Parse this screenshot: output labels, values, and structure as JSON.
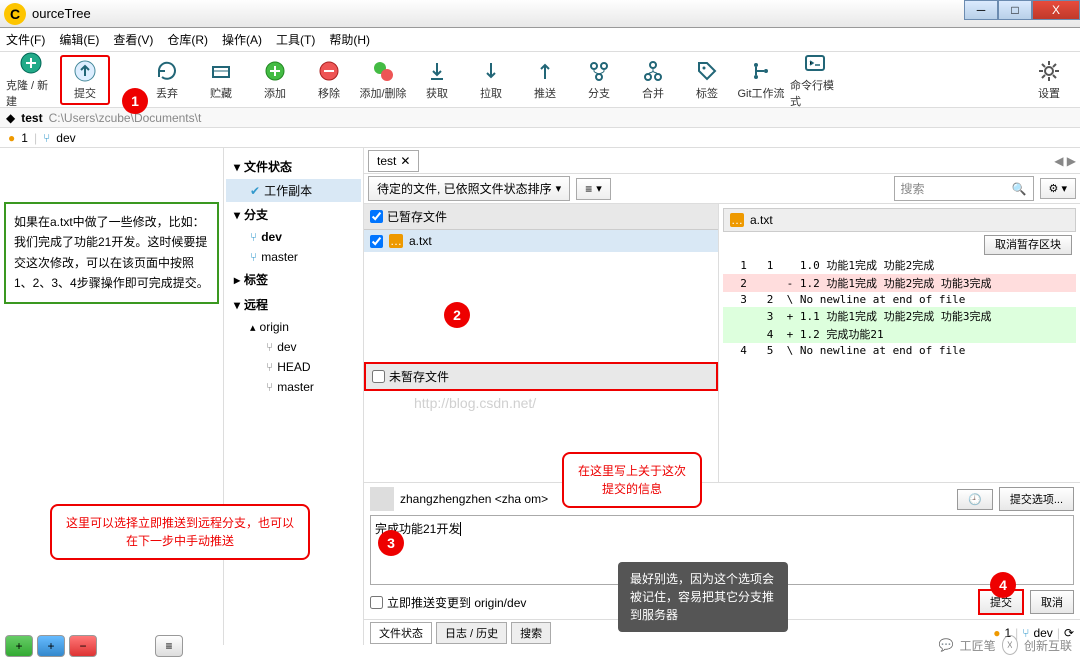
{
  "window": {
    "title": "ourceTree",
    "min": "_",
    "max": "□",
    "close": "X"
  },
  "menu": [
    "文件(F)",
    "编辑(E)",
    "查看(V)",
    "仓库(R)",
    "操作(A)",
    "工具(T)",
    "帮助(H)"
  ],
  "toolbar": [
    {
      "label": "克隆 / 新建",
      "icon": "clone"
    },
    {
      "label": "提交",
      "icon": "commit",
      "hl": true
    },
    {
      "label": "丢弃",
      "icon": "discard"
    },
    {
      "label": "贮藏",
      "icon": "stash"
    },
    {
      "label": "添加",
      "icon": "add"
    },
    {
      "label": "移除",
      "icon": "remove"
    },
    {
      "label": "添加/删除",
      "icon": "addremove"
    },
    {
      "label": "获取",
      "icon": "fetch"
    },
    {
      "label": "拉取",
      "icon": "pull"
    },
    {
      "label": "推送",
      "icon": "push"
    },
    {
      "label": "分支",
      "icon": "branch"
    },
    {
      "label": "合并",
      "icon": "merge"
    },
    {
      "label": "标签",
      "icon": "tag"
    },
    {
      "label": "Git工作流",
      "icon": "flow"
    },
    {
      "label": "命令行模式",
      "icon": "terminal"
    }
  ],
  "settings_label": "设置",
  "path": {
    "repo": "test",
    "full": "C:\\Users\\zcube\\Documents\\t"
  },
  "branch_badge": "1",
  "branch_current": "dev",
  "note_text": "如果在a.txt中做了一些修改，比如：我们完成了功能21开发。这时候要提交这次修改，可以在该页面中按照1、2、3、4步骤操作即可完成提交。",
  "tree": {
    "file_status": "文件状态",
    "working_copy": "工作副本",
    "branches": "分支",
    "dev": "dev",
    "master_b": "master",
    "tags": "标签",
    "remotes": "远程",
    "origin": "origin",
    "r_dev": "dev",
    "r_head": "HEAD",
    "r_master": "master"
  },
  "tab": "test",
  "sort_label": "待定的文件, 已依照文件状态排序",
  "view_btn": "≡",
  "search_ph": "搜索",
  "staged_hdr": "已暂存文件",
  "staged_file": "a.txt",
  "unstaged_hdr": "未暂存文件",
  "ghost_url": "http://blog.csdn.net/",
  "diff": {
    "file": "a.txt",
    "unstage_btn": "取消暂存区块",
    "lines": [
      {
        "t": "ctx",
        "ol": "1",
        "nl": "1",
        "txt": "  1.0 功能1完成 功能2完成"
      },
      {
        "t": "del",
        "ol": "2",
        "nl": "",
        "txt": "- 1.2 功能1完成 功能2完成 功能3完成"
      },
      {
        "t": "ctx",
        "ol": "3",
        "nl": "2",
        "txt": "\\ No newline at end of file"
      },
      {
        "t": "add",
        "ol": "",
        "nl": "3",
        "txt": "+ 1.1 功能1完成 功能2完成 功能3完成"
      },
      {
        "t": "add",
        "ol": "",
        "nl": "4",
        "txt": "+ 1.2 完成功能21"
      },
      {
        "t": "ctx",
        "ol": "4",
        "nl": "5",
        "txt": "\\ No newline at end of file"
      }
    ]
  },
  "commit": {
    "user": "zhangzhengzhen <zha                                           om>",
    "msg": "完成功能21开发",
    "push_checkbox": "立即推送变更到 origin/dev",
    "options": "提交选项...",
    "commit_btn": "提交",
    "cancel_btn": "取消"
  },
  "callout1": "在这里写上关于这次提交的信息",
  "callout2": "这里可以选择立即推送到远程分支，也可以在下一步中手动推送",
  "callout3": "最好别选，因为这个选项会被记住，容易把其它分支推到服务器",
  "status_tabs": [
    "文件状态",
    "日志 / 历史",
    "搜索"
  ],
  "status_right": {
    "pending": "1",
    "branch": "dev"
  },
  "wm": "创新互联"
}
